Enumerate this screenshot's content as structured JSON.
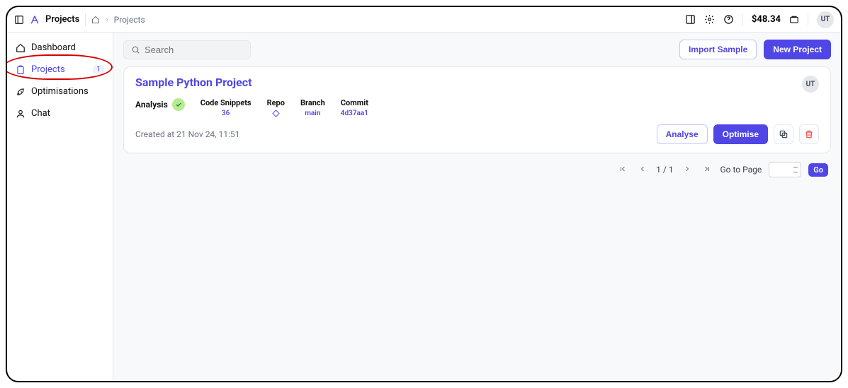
{
  "header": {
    "app_title": "Projects",
    "breadcrumb_current": "Projects",
    "balance": "$48.34",
    "user_initials": "UT"
  },
  "sidebar": {
    "items": [
      {
        "label": "Dashboard",
        "icon": "home-icon"
      },
      {
        "label": "Projects",
        "icon": "clipboard-icon",
        "badge": "1"
      },
      {
        "label": "Optimisations",
        "icon": "rocket-icon"
      },
      {
        "label": "Chat",
        "icon": "user-icon"
      }
    ]
  },
  "toolbar": {
    "search_placeholder": "Search",
    "import_label": "Import Sample",
    "new_label": "New Project"
  },
  "project": {
    "title": "Sample Python Project",
    "avatar": "UT",
    "analysis_label": "Analysis",
    "cols": {
      "snippets_label": "Code Snippets",
      "snippets_val": "36",
      "repo_label": "Repo",
      "branch_label": "Branch",
      "branch_val": "main",
      "commit_label": "Commit",
      "commit_val": "4d37aa1"
    },
    "created": "Created at 21 Nov 24, 11:51",
    "analyse_label": "Analyse",
    "optimise_label": "Optimise"
  },
  "pager": {
    "text": "1 / 1",
    "goto_label": "Go to Page",
    "go_label": "Go"
  }
}
